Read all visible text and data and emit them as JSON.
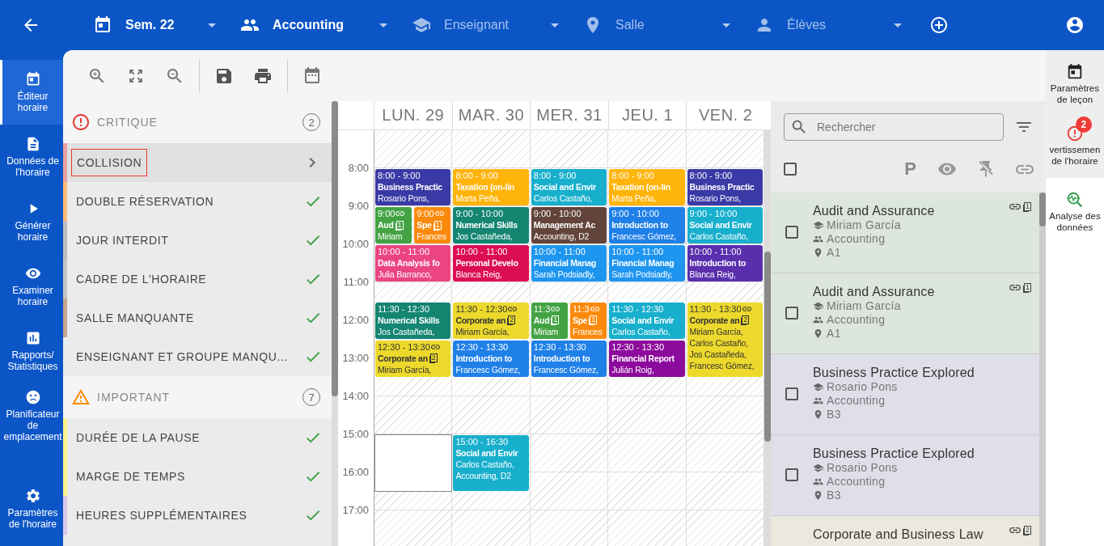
{
  "top_bar": {
    "selectors": [
      {
        "label": "Sem. 22",
        "filled": true
      },
      {
        "label": "Accounting",
        "filled": true
      },
      {
        "label": "Enseignant",
        "filled": false
      },
      {
        "label": "Salle",
        "filled": false
      },
      {
        "label": "Élèves",
        "filled": false
      }
    ]
  },
  "nav": {
    "items": [
      {
        "label": "Éditeur horaire",
        "selected": true
      },
      {
        "label": "Données de l'horaire",
        "selected": false
      },
      {
        "label": "Générer horaire",
        "selected": false
      },
      {
        "label": "Examiner horaire",
        "selected": false
      },
      {
        "label": "Rapports/ Statistiques",
        "selected": false
      },
      {
        "label": "Planificateur de emplacement",
        "selected": false
      },
      {
        "label": "Paramètres de l'horaire",
        "selected": false
      }
    ]
  },
  "warnings": {
    "sections": [
      {
        "title": "CRITIQUE",
        "kind": "critical",
        "count": "2",
        "items": [
          {
            "label": "COLLISION",
            "color": "#e8a1a1",
            "kind": "open",
            "selected": true
          },
          {
            "label": "DOUBLE RÉSERVATION",
            "color": "#ffbb77",
            "kind": "ok",
            "selected": false
          },
          {
            "label": "JOUR INTERDIT",
            "color": "#bdbdbd",
            "kind": "ok",
            "selected": false
          },
          {
            "label": "CADRE DE L'HORAIRE",
            "color": "#c4c4c4",
            "kind": "ok",
            "selected": false
          },
          {
            "label": "SALLE MANQUANTE",
            "color": "#c4a590",
            "kind": "ok",
            "selected": false
          },
          {
            "label": "ENSEIGNANT ET GROUPE MANQU...",
            "kind": "ok",
            "selected": false
          }
        ]
      },
      {
        "title": "IMPORTANT",
        "kind": "important",
        "count": "7",
        "items": [
          {
            "label": "DURÉE DE LA PAUSE",
            "color": "#fbf28a",
            "kind": "ok",
            "selected": false
          },
          {
            "label": "MARGE DE TEMPS",
            "color": "#fbf28a",
            "kind": "ok",
            "selected": false
          },
          {
            "label": "HEURES SUPPLÉMENTAIRES",
            "color": "#d8c8ec",
            "kind": "ok",
            "selected": false
          }
        ]
      }
    ]
  },
  "calendar": {
    "hours": [
      "8:00",
      "9:00",
      "10:00",
      "11:00",
      "12:00",
      "13:00",
      "14:00",
      "15:00",
      "16:00",
      "17:00"
    ],
    "days": [
      {
        "label": "LUN. 29",
        "events": [
          {
            "time": "8:00 - 9:00",
            "title": "Business Practic",
            "lines": [
              "Rosario Pons,"
            ],
            "color": "#3a3aa6",
            "kind": "full",
            "linked": false
          },
          {
            "time": "9:00",
            "title": "Aud",
            "lines": [
              "Miriam"
            ],
            "color": "#43a343",
            "kind": "left",
            "linked": true,
            "badge": "1"
          },
          {
            "time": "9:00",
            "title": "Spe",
            "lines": [
              "Frances"
            ],
            "color": "#fb8a0c",
            "kind": "right",
            "linked": true,
            "badge": "1"
          },
          {
            "time": "10:00 - 11:00",
            "title": "Data Analysis fo",
            "lines": [
              "Julia Barranco,"
            ],
            "color": "#ea4580",
            "kind": "full",
            "linked": false
          },
          {
            "time": "11:30 - 12:30",
            "title": "Numerical Skills",
            "lines": [
              "Jos Castañeda,"
            ],
            "color": "#138571",
            "kind": "full",
            "linked": false
          },
          {
            "time": "12:30 - 13:30",
            "title": "Corporate an",
            "lines": [
              "Miriam García,"
            ],
            "color": "#ecd92c",
            "kind": "full",
            "linked": true,
            "badge": "2"
          }
        ]
      },
      {
        "label": "MAR. 30",
        "events": [
          {
            "time": "8:00 - 9:00",
            "title": "Taxation (on-lin",
            "lines": [
              "Marta Peña,"
            ],
            "color": "#ffb40a",
            "kind": "full",
            "linked": false
          },
          {
            "time": "9:00 - 10:00",
            "title": "Numerical Skills",
            "lines": [
              "Jos Castañeda,"
            ],
            "color": "#138571",
            "kind": "full",
            "linked": false
          },
          {
            "time": "10:00 - 11:00",
            "title": "Personal Develo",
            "lines": [
              "Blanca Reig,"
            ],
            "color": "#dc0d55",
            "kind": "full",
            "linked": false
          },
          {
            "time": "11:30 - 12:30",
            "title": "Corporate an",
            "lines": [
              "Miriam García,"
            ],
            "color": "#ecd92c",
            "kind": "full",
            "linked": true,
            "badge": "2"
          },
          {
            "time": "12:30 - 13:30",
            "title": "Introduction to",
            "lines": [
              "Francesc Gómez,"
            ],
            "color": "#1f80e8",
            "kind": "full",
            "linked": false
          },
          {
            "time": "15:00 - 16:30",
            "title": "Social and Envir",
            "lines": [
              "Carlos Castaño,",
              "Accounting, D2"
            ],
            "color": "#17afcc",
            "kind": "full",
            "linked": false
          }
        ]
      },
      {
        "label": "MER. 31",
        "events": [
          {
            "time": "8:00 - 9:00",
            "title": "Social and Envir",
            "lines": [
              "Carlos Castaño,"
            ],
            "color": "#17afcc",
            "kind": "full",
            "linked": false
          },
          {
            "time": "9:00 - 10:00",
            "title": "Management Ac",
            "lines": [
              "Accounting, D2"
            ],
            "color": "#62443a",
            "kind": "full",
            "linked": false
          },
          {
            "time": "10:00 - 11:00",
            "title": "Financial Manag",
            "lines": [
              "Sarah Podsiadly,"
            ],
            "color": "#1e96f0",
            "kind": "full",
            "linked": false
          },
          {
            "time": "11:3",
            "title": "Aud",
            "lines": [
              "Miriam"
            ],
            "color": "#43a343",
            "kind": "left",
            "linked": true,
            "badge": "1"
          },
          {
            "time": "11:3",
            "title": "Spe",
            "lines": [
              "Frances"
            ],
            "color": "#fb8a0c",
            "kind": "right",
            "linked": true,
            "badge": "1"
          },
          {
            "time": "12:30 - 13:30",
            "title": "Introduction to",
            "lines": [
              "Francesc Gómez,"
            ],
            "color": "#1f80e8",
            "kind": "full",
            "linked": false
          }
        ]
      },
      {
        "label": "JEU. 1",
        "events": [
          {
            "time": "8:00 - 9:00",
            "title": "Taxation (on-lin",
            "lines": [
              "Marta Peña,"
            ],
            "color": "#ffb40a",
            "kind": "full",
            "linked": false
          },
          {
            "time": "9:00 - 10:00",
            "title": "Introduction to",
            "lines": [
              "Francesc Gómez,"
            ],
            "color": "#1f80e8",
            "kind": "full",
            "linked": false
          },
          {
            "time": "10:00 - 11:00",
            "title": "Financial Manag",
            "lines": [
              "Sarah Podsiadly,"
            ],
            "color": "#1e96f0",
            "kind": "full",
            "linked": false
          },
          {
            "time": "11:30 - 12:30",
            "title": "Social and Envir",
            "lines": [
              "Carlos Castaño,"
            ],
            "color": "#17afcc",
            "kind": "full",
            "linked": false
          },
          {
            "time": "12:30 - 13:30",
            "title": "Financial Report",
            "lines": [
              "Julián Roig,"
            ],
            "color": "#8c0a9c",
            "kind": "full",
            "linked": false
          }
        ]
      },
      {
        "label": "VEN. 2",
        "events": [
          {
            "time": "8:00 - 9:00",
            "title": "Business Practic",
            "lines": [
              "Rosario Pons,"
            ],
            "color": "#3a3aa6",
            "kind": "full",
            "linked": false
          },
          {
            "time": "9:00 - 10:00",
            "title": "Social and Envir",
            "lines": [
              "Carlos Castaño,"
            ],
            "color": "#17afcc",
            "kind": "full",
            "linked": false
          },
          {
            "time": "10:00 - 11:00",
            "title": "Introduction to",
            "lines": [
              "Blanca Reig,"
            ],
            "color": "#5a2fae",
            "kind": "full",
            "linked": false
          },
          {
            "time": "11:30 - 13:30",
            "title": "Corporate an",
            "lines": [
              "Miriam García,",
              "Carlos Castaño,",
              "Jos Castañeda,",
              "Francesc Gómez,"
            ],
            "color": "#ecd92c",
            "kind": "full",
            "linked": true,
            "badge": "2"
          }
        ]
      }
    ]
  },
  "lessons": {
    "search": {
      "placeholder": "Rechercher"
    },
    "select_all": {
      "checked": false
    },
    "priority_mark": "P",
    "items": [
      {
        "title": "Audit and Assurance",
        "teacher": "Miriam García",
        "group": "Accounting",
        "room": "A1",
        "color": "#dde6dd",
        "checked": false,
        "linked": true,
        "badge": "1"
      },
      {
        "title": "Audit and Assurance",
        "teacher": "Miriam García",
        "group": "Accounting",
        "room": "A1",
        "color": "#dde6dd",
        "checked": false,
        "linked": true,
        "badge": "1"
      },
      {
        "title": "Business Practice Explored",
        "teacher": "Rosario Pons",
        "group": "Accounting",
        "room": "B3",
        "color": "#dfdfe9",
        "checked": false,
        "linked": false
      },
      {
        "title": "Business Practice Explored",
        "teacher": "Rosario Pons",
        "group": "Accounting",
        "room": "B3",
        "color": "#dfdfe9",
        "checked": false,
        "linked": false
      },
      {
        "title": "Corporate and Business Law",
        "color": "#ebe9dd",
        "linked": true,
        "badge": "2"
      }
    ]
  },
  "rail": {
    "items": [
      {
        "label": "Paramètres de leçon"
      },
      {
        "label": "vertissemen de l'horaire",
        "badge": "2"
      },
      {
        "label": "Analyse des données"
      }
    ]
  }
}
